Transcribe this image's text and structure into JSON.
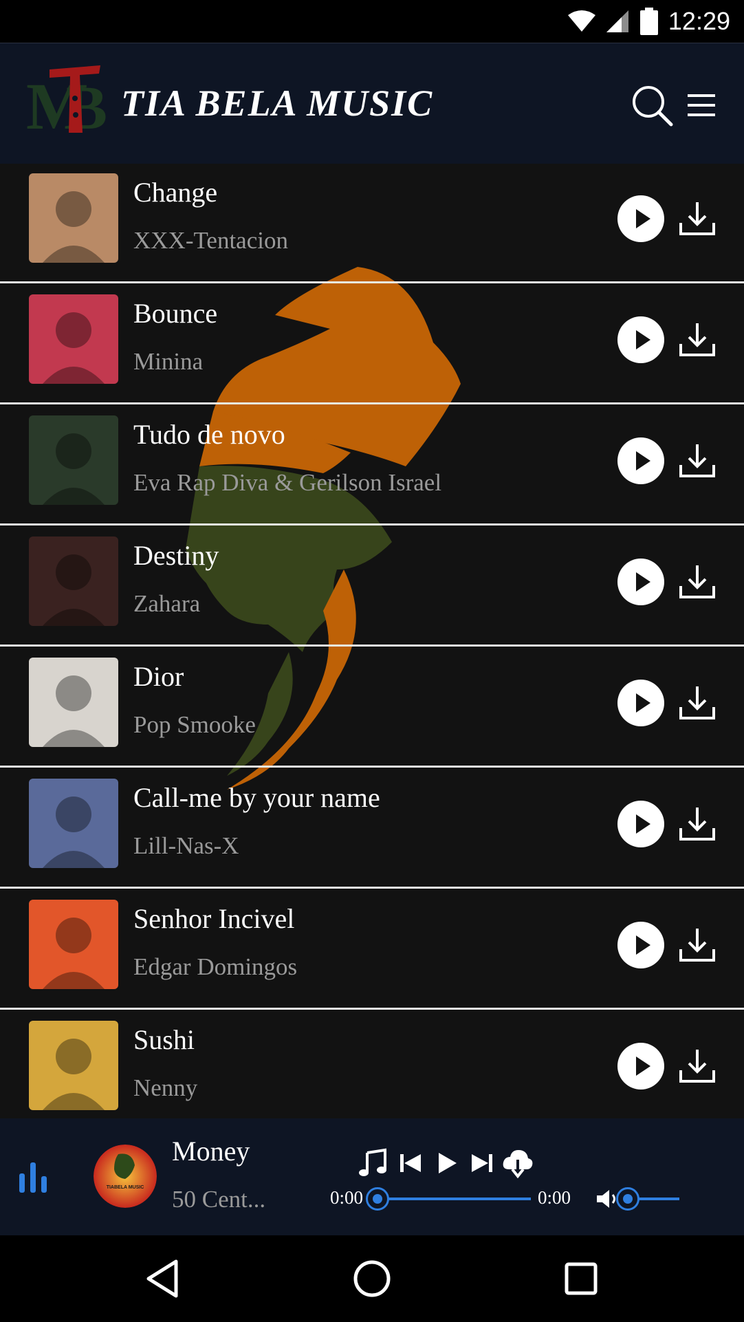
{
  "status_bar": {
    "time": "12:29",
    "icons": [
      "wifi-icon",
      "signal-icon",
      "battery-icon"
    ]
  },
  "header": {
    "logo_text": "MTB",
    "title": "TIA BELA MUSIC",
    "icons": [
      "search-icon",
      "menu-icon"
    ]
  },
  "tracks": [
    {
      "title": "Change",
      "artist": "XXX-Tentacion",
      "thumb_color": "#b98a66"
    },
    {
      "title": "Bounce",
      "artist": "Minina",
      "thumb_color": "#c2394f"
    },
    {
      "title": "Tudo de novo",
      "artist": "Eva Rap Diva & Gerilson Israel",
      "thumb_color": "#2a3a2a"
    },
    {
      "title": "Destiny",
      "artist": "Zahara",
      "thumb_color": "#3a2220"
    },
    {
      "title": "Dior",
      "artist": "Pop Smooke",
      "thumb_color": "#d8d4ce"
    },
    {
      "title": "Call-me by your name",
      "artist": "Lill-Nas-X",
      "thumb_color": "#5a6a9a"
    },
    {
      "title": "Senhor Incivel",
      "artist": "Edgar Domingos",
      "thumb_color": "#e2562a"
    },
    {
      "title": "Sushi",
      "artist": "Nenny",
      "thumb_color": "#d4a63c"
    }
  ],
  "player": {
    "title": "Money",
    "artist": "50 Cent...",
    "current_time": "0:00",
    "duration": "0:00",
    "progress": 0,
    "volume": 0,
    "cover_text": "TIABELA MUSIC"
  },
  "colors": {
    "accent": "#2f7fe0",
    "header_bg": "#0e1524",
    "list_bg": "#121212",
    "emblem_orange": "#d16a05",
    "emblem_green": "#3c4a1c"
  }
}
